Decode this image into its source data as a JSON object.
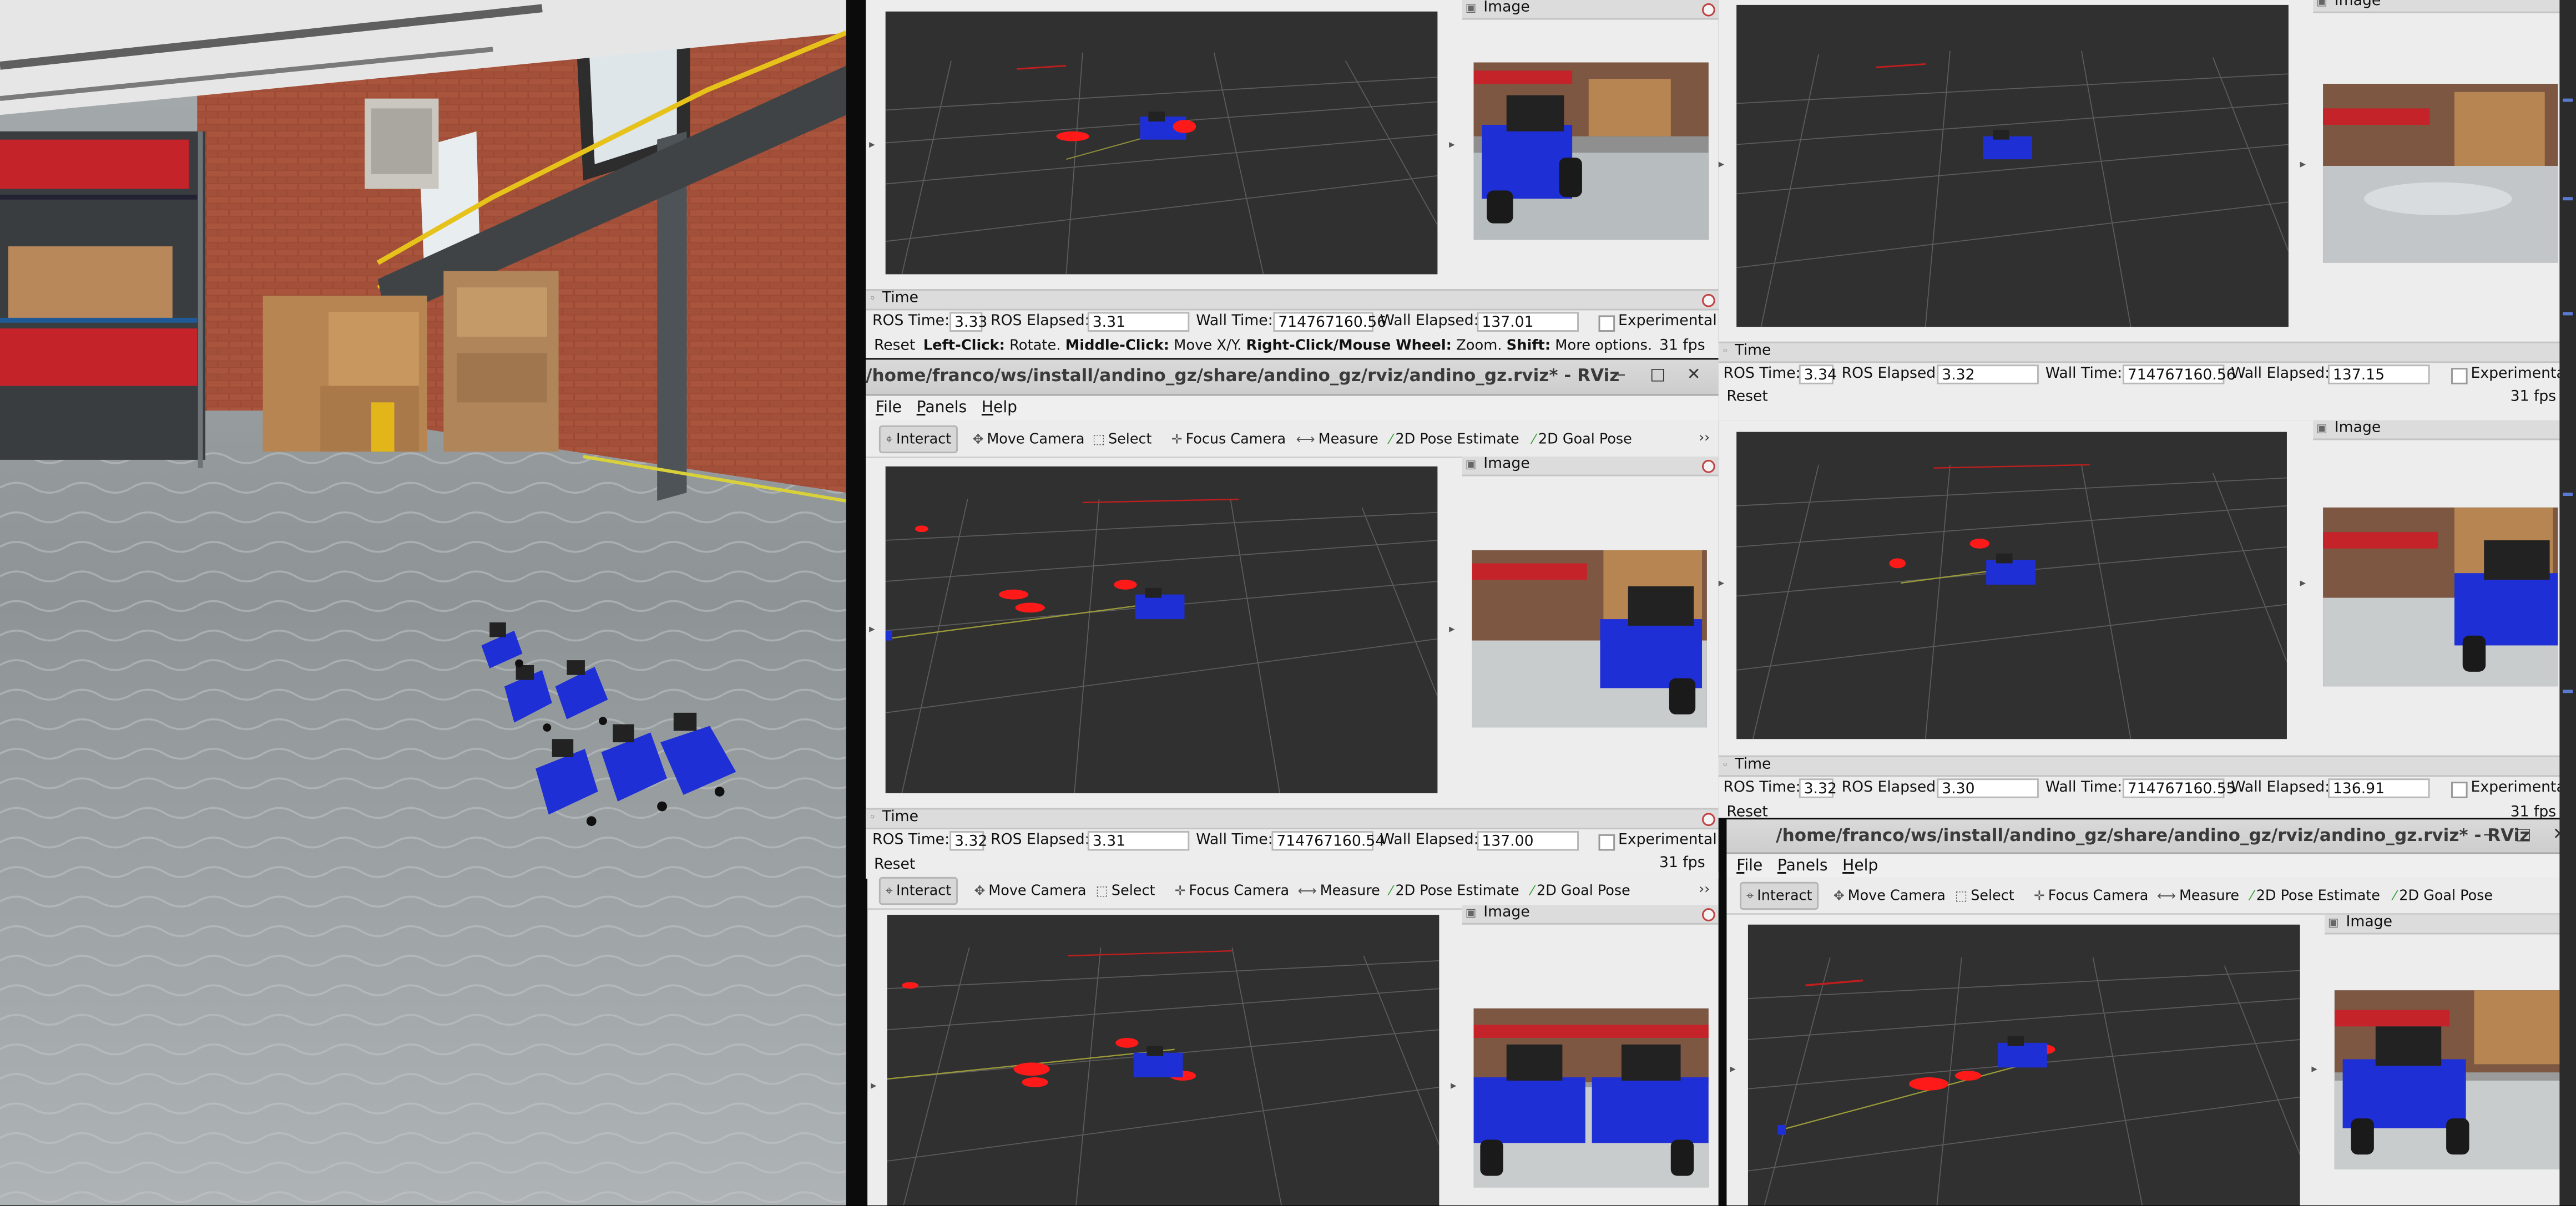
{
  "windows": {
    "top_left": {
      "image_panel_title": "Image",
      "time_panel_title": "Time",
      "labels": {
        "ros_time": "ROS Time:",
        "ros_elapsed": "ROS Elapsed:",
        "wall_time": "Wall Time:",
        "wall_elapsed": "Wall Elapsed:",
        "experimental": "Experimental"
      },
      "ros_time": "3.33",
      "ros_elapsed": "3.31",
      "wall_time": "714767160.56",
      "wall_elapsed": "137.01",
      "reset_label": "Reset",
      "hint": {
        "k1": "Left-Click:",
        "v1": " Rotate. ",
        "k2": "Middle-Click:",
        "v2": " Move X/Y. ",
        "k3": "Right-Click/Mouse Wheel:",
        "v3": " Zoom. ",
        "k4": "Shift:",
        "v4": " More options."
      },
      "fps": "31 fps"
    },
    "top_right": {
      "image_panel_title": "Image",
      "time_panel_title": "Time",
      "labels": {
        "ros_time": "ROS Time:",
        "ros_elapsed": "ROS Elapsed:",
        "wall_time": "Wall Time:",
        "wall_elapsed": "Wall Elapsed:",
        "experimental": "Experimental"
      },
      "ros_time": "3.34",
      "ros_elapsed": "3.32",
      "wall_time": "714767160.56",
      "wall_elapsed": "137.15",
      "reset_label": "Reset",
      "fps": "31 fps"
    },
    "middle_left": {
      "title": "/home/franco/ws/install/andino_gz/share/andino_gz/rviz/andino_gz.rviz* - RViz",
      "menus": [
        "File",
        "Panels",
        "Help"
      ],
      "tools": [
        "Interact",
        "Move Camera",
        "Select",
        "Focus Camera",
        "Measure",
        "2D Pose Estimate",
        "2D Goal Pose"
      ],
      "image_panel_title": "Image",
      "time_panel_title": "Time",
      "labels": {
        "ros_time": "ROS Time:",
        "ros_elapsed": "ROS Elapsed:",
        "wall_time": "Wall Time:",
        "wall_elapsed": "Wall Elapsed:",
        "experimental": "Experimental"
      },
      "ros_time": "3.32",
      "ros_elapsed": "3.31",
      "wall_time": "714767160.54",
      "wall_elapsed": "137.00",
      "reset_label": "Reset",
      "fps": "31 fps"
    },
    "middle_right": {
      "image_panel_title": "Image",
      "time_panel_title": "Time",
      "labels": {
        "ros_time": "ROS Time:",
        "ros_elapsed": "ROS Elapsed:",
        "wall_time": "Wall Time:",
        "wall_elapsed": "Wall Elapsed:",
        "experimental": "Experimental"
      },
      "ros_time": "3.32",
      "ros_elapsed": "3.30",
      "wall_time": "714767160.55",
      "wall_elapsed": "136.91",
      "reset_label": "Reset",
      "fps": "31 fps"
    },
    "bottom_left": {
      "tools": [
        "Interact",
        "Move Camera",
        "Select",
        "Focus Camera",
        "Measure",
        "2D Pose Estimate",
        "2D Goal Pose"
      ],
      "image_panel_title": "Image"
    },
    "bottom_right": {
      "title": "/home/franco/ws/install/andino_gz/share/andino_gz/rviz/andino_gz.rviz* - RViz",
      "menus": [
        "File",
        "Panels",
        "Help"
      ],
      "tools": [
        "Interact",
        "Move Camera",
        "Select",
        "Focus Camera",
        "Measure",
        "2D Pose Estimate",
        "2D Goal Pose"
      ],
      "image_panel_title": "Image"
    }
  },
  "icons": [
    "cursor-icon",
    "move-camera-icon",
    "select-icon",
    "focus-camera-icon",
    "measure-icon",
    "pose-estimate-icon",
    "goal-pose-icon",
    "minimize-icon",
    "maximize-icon",
    "close-icon",
    "panel-close-icon",
    "overflow-chevron-icon"
  ],
  "colors": {
    "viewport_bg": "#303030",
    "window_bg": "#ededed",
    "robot_blue": "#1f2fd6",
    "laser_red": "#ff1a1a"
  }
}
